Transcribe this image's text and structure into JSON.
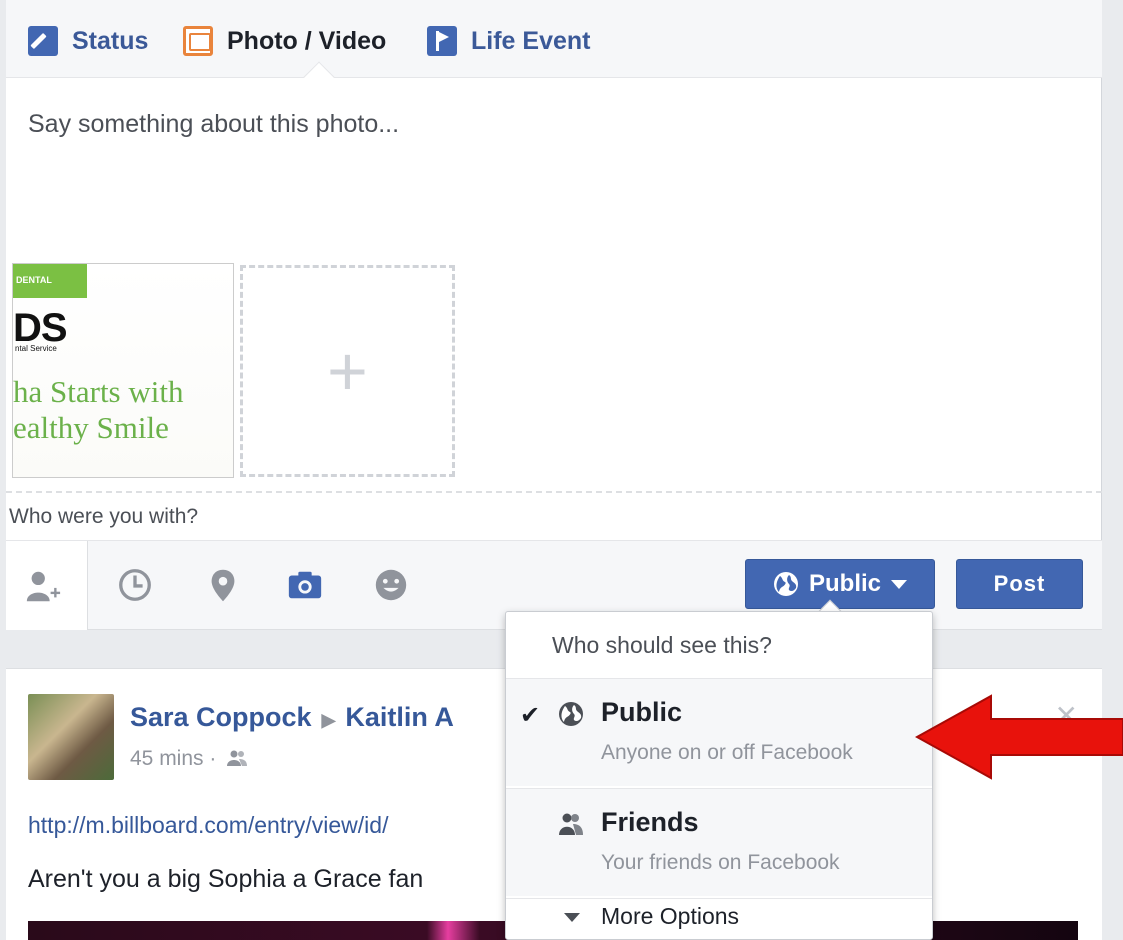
{
  "composer": {
    "tabs": [
      {
        "label": "Status",
        "icon": "pencil-icon"
      },
      {
        "label": "Photo / Video",
        "icon": "photo-icon"
      },
      {
        "label": "Life Event",
        "icon": "flag-icon"
      }
    ],
    "placeholder": "Say something about this photo...",
    "thumbnail": {
      "badge": "DENTAL",
      "headline": "DS",
      "subline": "ntal Service",
      "tagline_1": "ha Starts with",
      "tagline_2": "ealthy Smile"
    },
    "add_photo_symbol": "+",
    "with_placeholder": "Who were you with?",
    "public_label": "Public",
    "post_label": "Post"
  },
  "audience_menu": {
    "heading": "Who should see this?",
    "options": [
      {
        "title": "Public",
        "subtitle": "Anyone on or off Facebook",
        "selected": true,
        "icon": "globe-icon"
      },
      {
        "title": "Friends",
        "subtitle": "Your friends on Facebook",
        "selected": false,
        "icon": "friends-icon"
      }
    ],
    "more_label": "More Options"
  },
  "feed_post": {
    "author": "Sara Coppock",
    "target": "Kaitlin A",
    "time": "45 mins ·",
    "link": "http://m.billboard.com/entry/view/id/",
    "text": "Aren't you a big Sophia a Grace fan"
  },
  "colors": {
    "accent": "#4267b2",
    "link": "#365899",
    "annotation_arrow": "#e8120c"
  }
}
